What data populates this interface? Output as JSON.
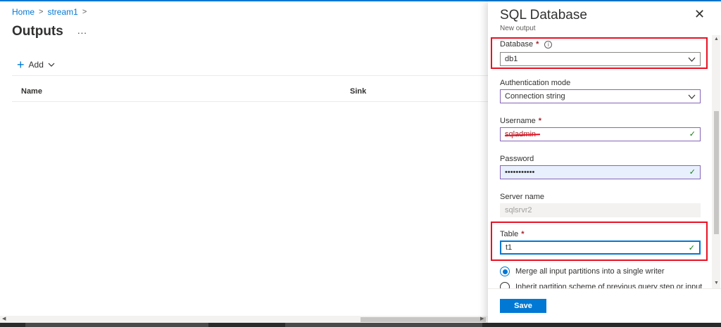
{
  "breadcrumb": {
    "home": "Home",
    "stream": "stream1",
    "separator": ">"
  },
  "page": {
    "title": "Outputs",
    "more": "..."
  },
  "toolbar": {
    "add_label": "Add"
  },
  "table": {
    "columns": [
      "Name",
      "Sink"
    ]
  },
  "panel": {
    "title": "SQL Database",
    "subtitle": "New output",
    "close": "✕",
    "fields": {
      "database": {
        "label": "Database",
        "value": "db1"
      },
      "auth_mode": {
        "label": "Authentication mode",
        "value": "Connection string"
      },
      "username": {
        "label": "Username",
        "value": "sqladmin"
      },
      "password": {
        "label": "Password",
        "value": "•••••••••••"
      },
      "server_name": {
        "label": "Server name",
        "value": "sqlsrvr2"
      },
      "table": {
        "label": "Table",
        "value": "t1"
      }
    },
    "required_mark": "*",
    "info": "i",
    "options": {
      "merge": "Merge all input partitions into a single writer",
      "inherit": "Inherit partition scheme of previous query step or input"
    },
    "save_label": "Save"
  },
  "icons": {
    "check": "✓",
    "chevron": "⌵",
    "plus": "+",
    "caret": "⌵"
  },
  "colors": {
    "accent": "#0078d4",
    "required": "#a4262c",
    "highlight": "#e81123",
    "success": "#107c10",
    "focus_border": "#8764b8"
  }
}
